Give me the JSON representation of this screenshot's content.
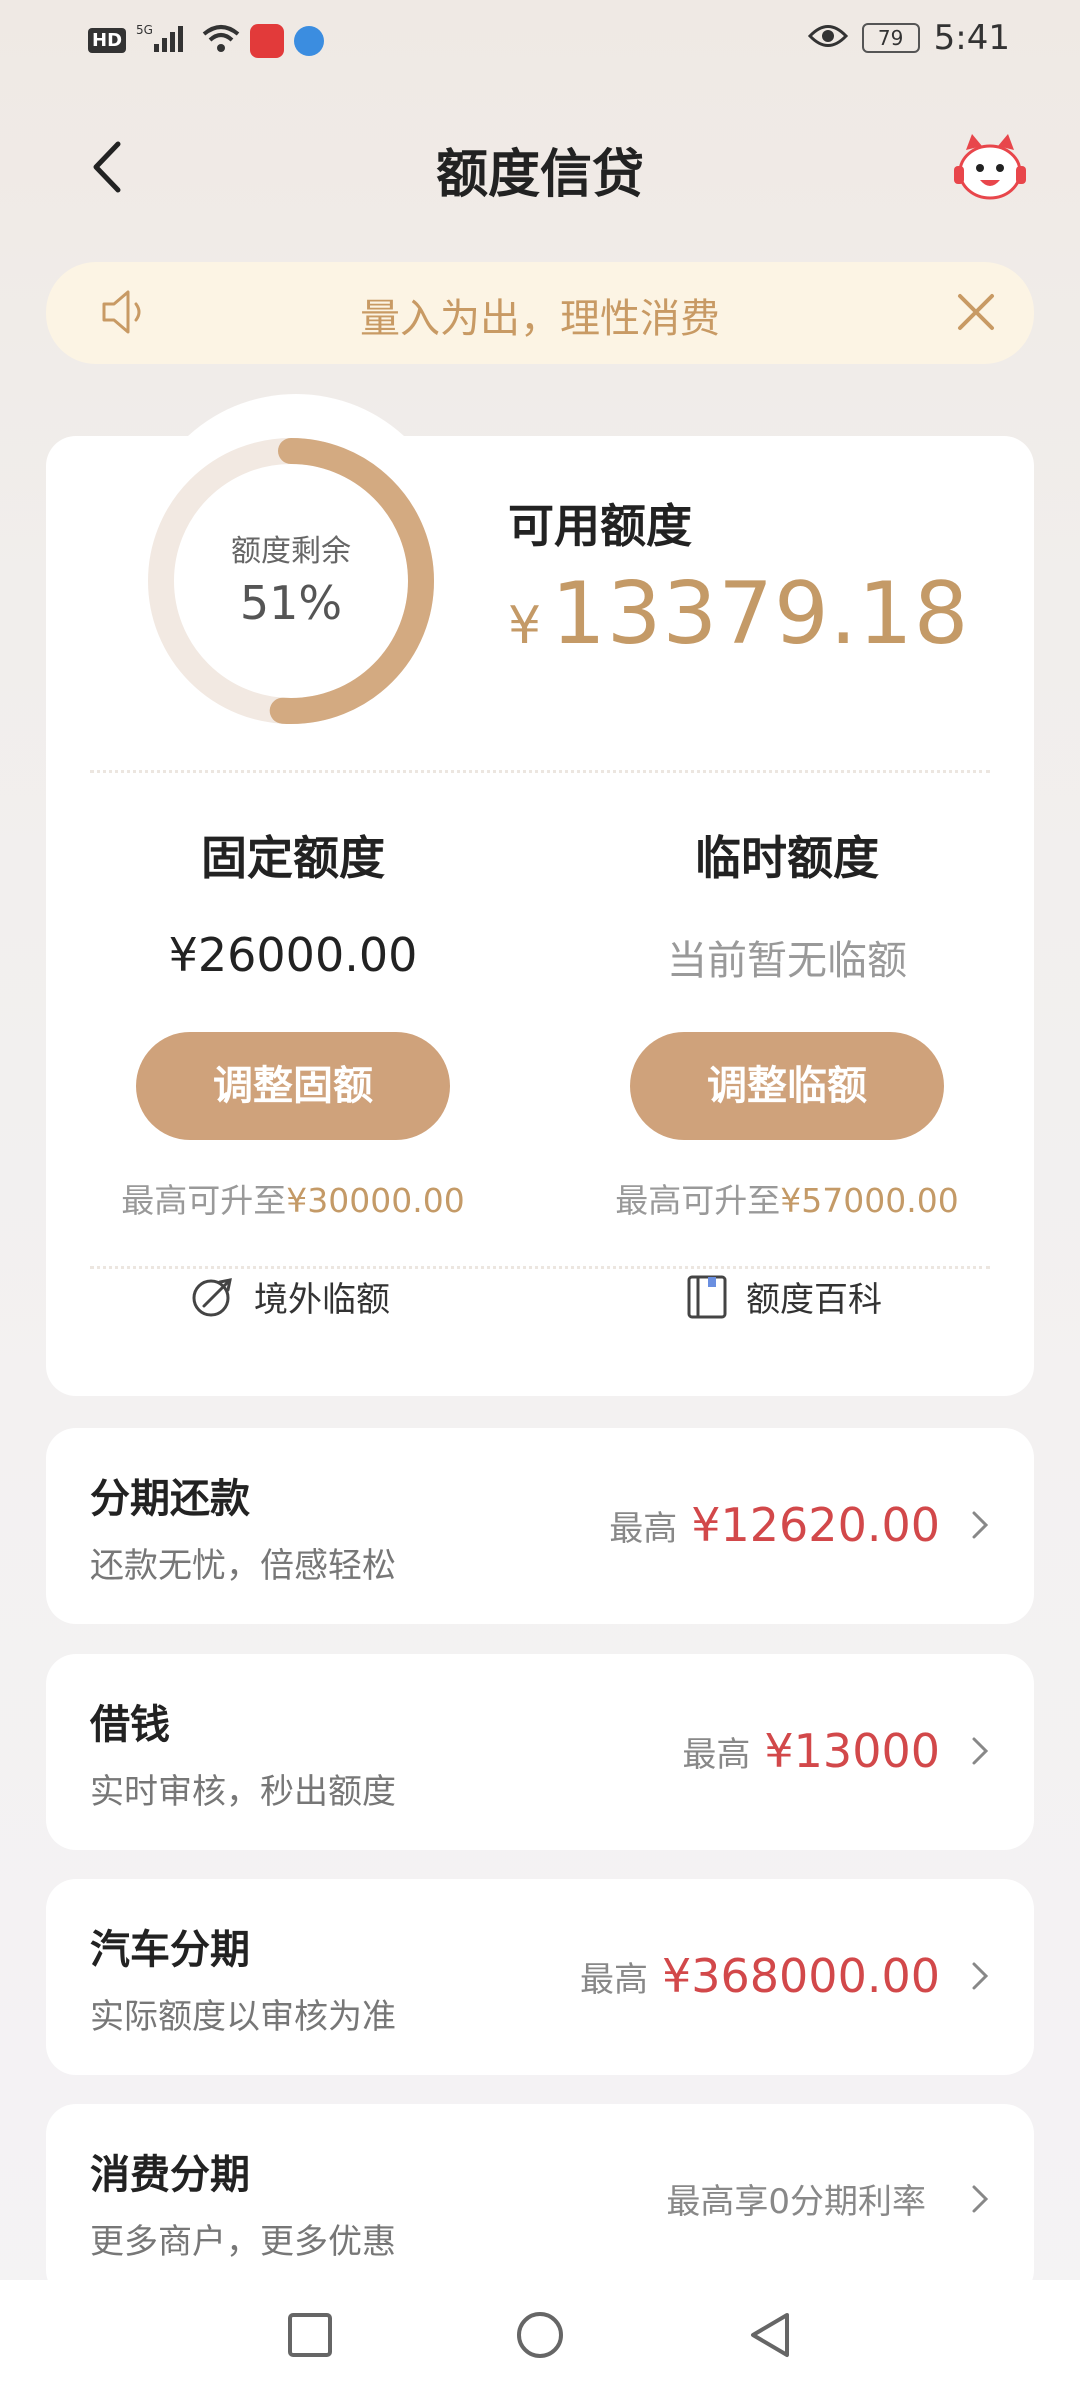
{
  "status_bar": {
    "hd": "HD",
    "network": "5G",
    "battery": "79",
    "time": "5:41"
  },
  "header": {
    "title": "额度信贷"
  },
  "notice": {
    "text": "量入为出，理性消费"
  },
  "credit_card": {
    "ring_label": "额度剩余",
    "ring_percent_text": "51%",
    "ring_fraction": 0.51,
    "available_label": "可用额度",
    "available_currency": "¥",
    "available_amount": "13379.18",
    "fixed": {
      "title": "固定额度",
      "amount": "¥26000.00",
      "button": "调整固额",
      "hint_prefix": "最高可升至",
      "hint_value": "¥30000.00"
    },
    "temp": {
      "title": "临时额度",
      "amount": "当前暂无临额",
      "button": "调整临额",
      "hint_prefix": "最高可升至",
      "hint_value": "¥57000.00"
    },
    "links": {
      "overseas": "境外临额",
      "encyclopedia": "额度百科"
    }
  },
  "products": [
    {
      "title": "分期还款",
      "subtitle": "还款无忧，倍感轻松",
      "prefix": "最高",
      "value": "¥12620.00"
    },
    {
      "title": "借钱",
      "subtitle": "实时审核，秒出额度",
      "prefix": "最高",
      "value": "¥13000"
    },
    {
      "title": "汽车分期",
      "subtitle": "实际额度以审核为准",
      "prefix": "最高",
      "value": "¥368000.00"
    },
    {
      "title": "消费分期",
      "subtitle": "更多商户，更多优惠",
      "prefix": "最高享0分期利率",
      "value": ""
    }
  ],
  "colors": {
    "gold": "#c49a67",
    "button": "#cfa27b",
    "red": "#d2484a",
    "notice_bg": "#fcf4e4"
  }
}
